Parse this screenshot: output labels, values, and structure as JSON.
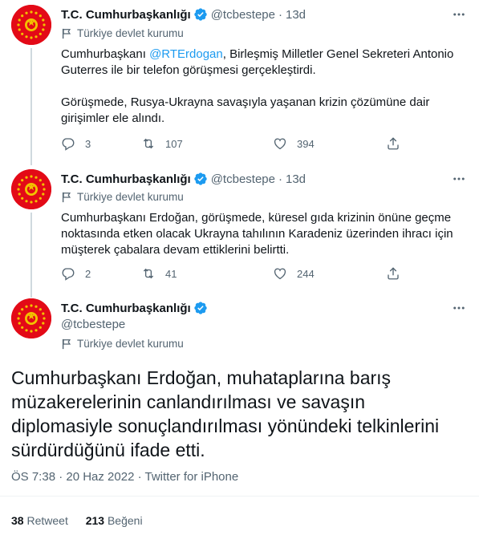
{
  "tweets": [
    {
      "name": "T.C. Cumhurbaşkanlığı",
      "handle": "@tcbestepe",
      "separator": "·",
      "time": "13d",
      "label": "Türkiye devlet kurumu",
      "text_prefix": "Cumhurbaşkanı ",
      "mention": "@RTErdogan",
      "text_rest": ", Birleşmiş Milletler Genel Sekreteri Antonio Guterres ile bir telefon görüşmesi gerçekleştirdi.\n\nGörüşmede, Rusya-Ukrayna savaşıyla yaşanan krizin çözümüne dair girişimler ele alındı.",
      "replies": "3",
      "retweets": "107",
      "likes": "394"
    },
    {
      "name": "T.C. Cumhurbaşkanlığı",
      "handle": "@tcbestepe",
      "separator": "·",
      "time": "13d",
      "label": "Türkiye devlet kurumu",
      "text": "Cumhurbaşkanı Erdoğan, görüşmede, küresel gıda krizinin önüne geçme noktasında etken olacak Ukrayna tahılının Karadeniz üzerinden ihracı için müşterek çabalara devam ettiklerini belirtti.",
      "replies": "2",
      "retweets": "41",
      "likes": "244"
    }
  ],
  "main_tweet": {
    "name": "T.C. Cumhurbaşkanlığı",
    "handle": "@tcbestepe",
    "label": "Türkiye devlet kurumu",
    "text": "Cumhurbaşkanı Erdoğan, muhataplarına barış müzakerelerinin canlandırılması ve savaşın diplomasiyle sonuçlandırılması yönündeki telkinlerini sürdürdüğünü ifade etti.",
    "timestamp": "ÖS 7:38 · 20 Haz 2022 · Twitter for iPhone",
    "retweet_count": "38",
    "retweet_label": "Retweet",
    "like_count": "213",
    "like_label": "Beğeni"
  },
  "colors": {
    "accent": "#1d9bf0",
    "secondary_text": "#536471",
    "avatar_red": "#e30a17",
    "gold": "#f2c200"
  },
  "icons": [
    "seal-icon",
    "verified-icon",
    "more-icon",
    "flag-icon",
    "reply-icon",
    "retweet-icon",
    "like-icon",
    "share-icon"
  ]
}
